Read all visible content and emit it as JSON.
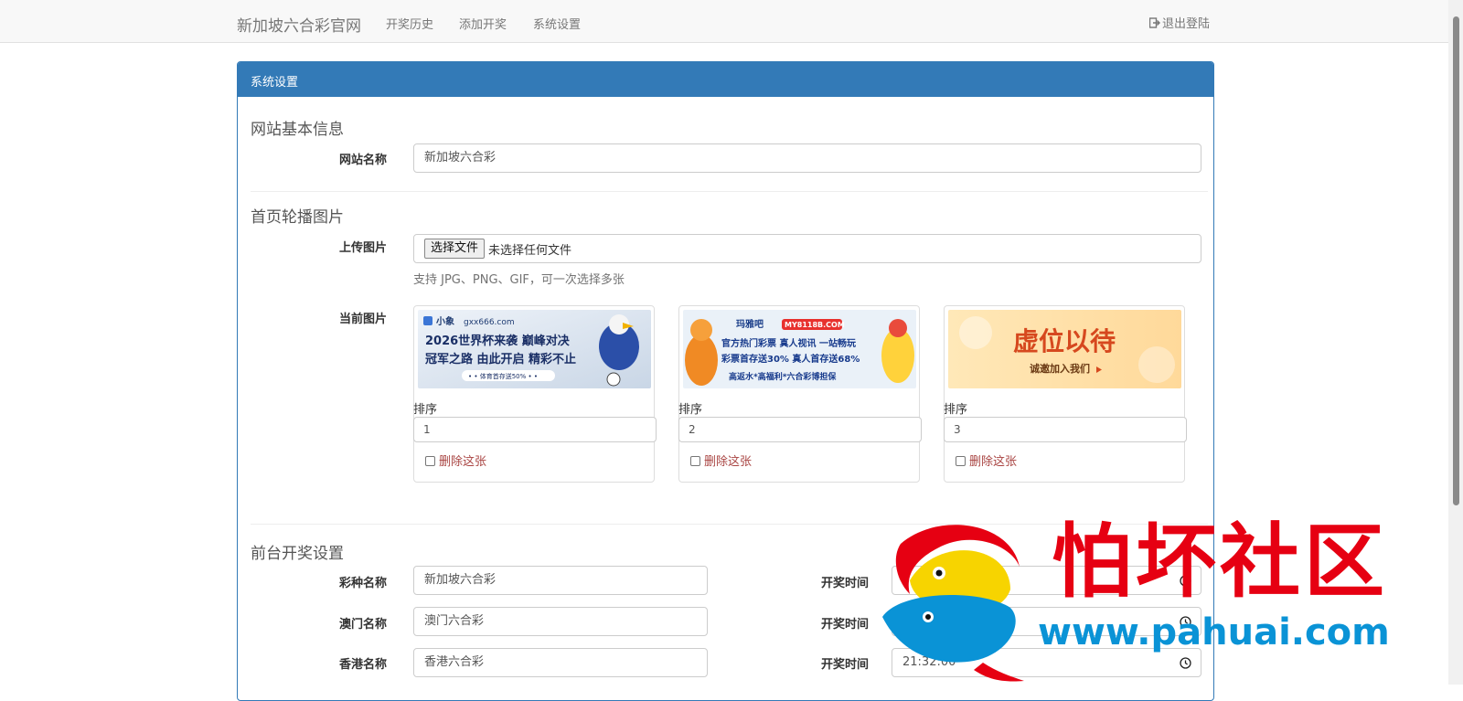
{
  "navbar": {
    "brand": "新加坡六合彩官网",
    "links": [
      "开奖历史",
      "添加开奖",
      "系统设置"
    ],
    "logout": "退出登陆"
  },
  "panel": {
    "heading": "系统设置",
    "basic": {
      "title": "网站基本信息",
      "site_name_label": "网站名称",
      "site_name_value": "新加坡六合彩"
    },
    "carousel": {
      "title": "首页轮播图片",
      "upload_label": "上传图片",
      "file_button": "选择文件",
      "file_status": "未选择任何文件",
      "help": "支持 JPG、PNG、GIF，可一次选择多张",
      "current_label": "当前图片",
      "sort_label": "排序",
      "delete_label": "删除这张",
      "images": [
        {
          "sort": "1",
          "brand": "小象",
          "site": "gxx666.com",
          "line1": "2026世界杯来袭 巅峰对决",
          "line2": "冠军之路 由此开启 精彩不止",
          "line3": "• • 体育首存送50% • •"
        },
        {
          "sort": "2",
          "brand": "玛雅吧",
          "site": "MY8118B.COM",
          "line1": "官方热门彩票 真人视讯 一站畅玩",
          "line2": "彩票首存送30% 真人首存送68%",
          "line3": "高返水*高福利*六合彩博担保"
        },
        {
          "sort": "3",
          "line1": "虚位以待",
          "line2": "诚邀加入我们"
        }
      ]
    },
    "draw": {
      "title": "前台开奖设置",
      "rows": [
        {
          "name_label": "彩种名称",
          "name_value": "新加坡六合彩",
          "time_label": "开奖时间",
          "time_value": ""
        },
        {
          "name_label": "澳门名称",
          "name_value": "澳门六合彩",
          "time_label": "开奖时间",
          "time_value": ""
        },
        {
          "name_label": "香港名称",
          "name_value": "香港六合彩",
          "time_label": "开奖时间",
          "time_value": "21:32:00"
        }
      ]
    }
  },
  "watermark": {
    "title": "怕坏社区",
    "url": "www.pahuai.com"
  },
  "colors": {
    "primary": "#337ab7",
    "danger": "#a94442",
    "watermark_red": "#e60012",
    "watermark_blue": "#0a93d6"
  }
}
